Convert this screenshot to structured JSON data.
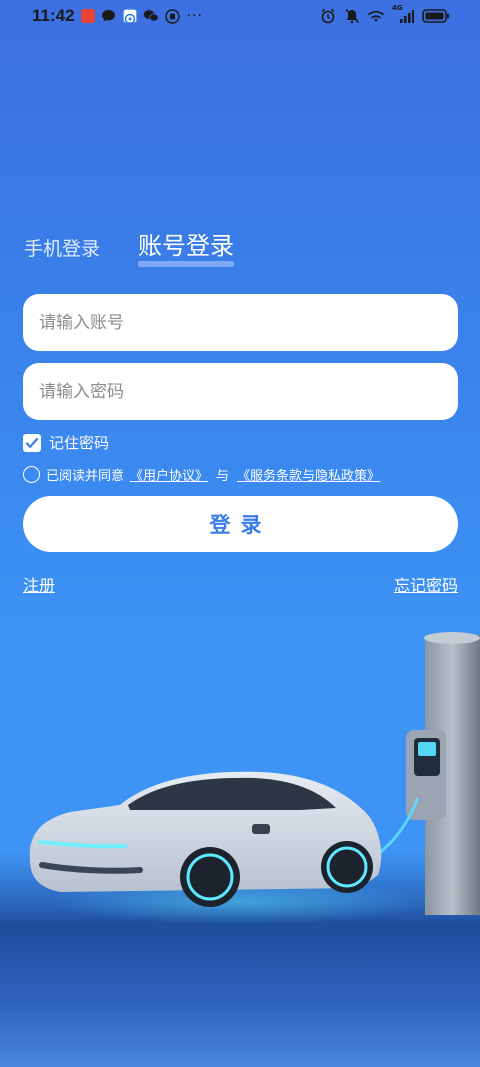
{
  "status_bar": {
    "time": "11:42",
    "dots": "···",
    "app_icons": [
      "app-icon-red",
      "message-icon",
      "browser-icon",
      "wechat-icon",
      "app-icon-round"
    ],
    "right_icons": [
      "alarm-icon",
      "mute-icon",
      "wifi-icon",
      "signal-icon",
      "battery-icon"
    ],
    "network_label": "4G"
  },
  "tabs": {
    "phone_login": "手机登录",
    "account_login": "账号登录"
  },
  "form": {
    "account_placeholder": "请输入账号",
    "password_placeholder": "请输入密码",
    "remember_label": "记住密码",
    "remember_checked": true,
    "agree_prefix": "已阅读并同意",
    "user_agreement": "《用户协议》",
    "agree_and": "与",
    "privacy_policy": "《服务条款与隐私政策》",
    "agree_checked": false,
    "login_label": "登录"
  },
  "links": {
    "register": "注册",
    "forgot_password": "忘记密码"
  },
  "colors": {
    "background_top": "#3d6fe0",
    "background_bottom": "#3f95f3",
    "login_text": "#3a7de8"
  }
}
